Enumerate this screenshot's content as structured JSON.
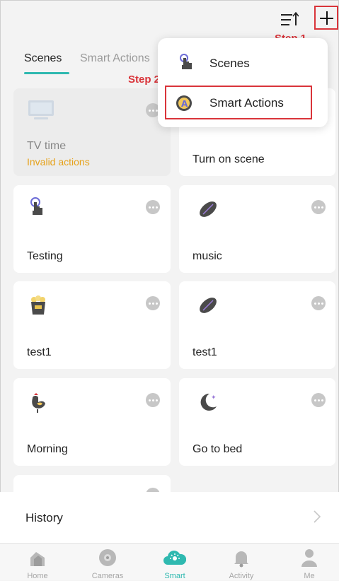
{
  "header": {
    "sort_icon": "sort-icon",
    "add_icon": "plus-icon"
  },
  "annotations": {
    "step1": "Step 1",
    "step2": "Step 2"
  },
  "tabs": [
    {
      "label": "Scenes",
      "active": true
    },
    {
      "label": "Smart Actions",
      "active": false
    }
  ],
  "dropdown": {
    "items": [
      {
        "label": "Scenes",
        "icon": "touch-hand-icon"
      },
      {
        "label": "Smart Actions",
        "icon": "smart-action-icon"
      }
    ]
  },
  "cards": [
    {
      "title": "TV time",
      "subtitle": "Invalid actions",
      "icon": "tv-icon",
      "disabled": true
    },
    {
      "title": "Turn on scene",
      "subtitle": "",
      "icon": "",
      "disabled": false
    },
    {
      "title": "Testing",
      "icon": "touch-hand-icon"
    },
    {
      "title": "music",
      "icon": "football-icon"
    },
    {
      "title": "test1",
      "icon": "popcorn-icon"
    },
    {
      "title": "test1",
      "icon": "football-icon"
    },
    {
      "title": "Morning",
      "icon": "rooster-icon"
    },
    {
      "title": "Go to bed",
      "icon": "moon-icon"
    }
  ],
  "history": {
    "label": "History"
  },
  "bottom_nav": [
    {
      "label": "Home",
      "icon": "home-icon",
      "active": false
    },
    {
      "label": "Cameras",
      "icon": "camera-icon",
      "active": false
    },
    {
      "label": "Smart",
      "icon": "smart-icon",
      "active": true
    },
    {
      "label": "Activity",
      "icon": "bell-icon",
      "active": false
    },
    {
      "label": "Me",
      "icon": "person-icon",
      "active": false
    }
  ],
  "colors": {
    "accent": "#2fb9b0",
    "highlight": "#d9343a",
    "warning": "#e6a21a"
  }
}
